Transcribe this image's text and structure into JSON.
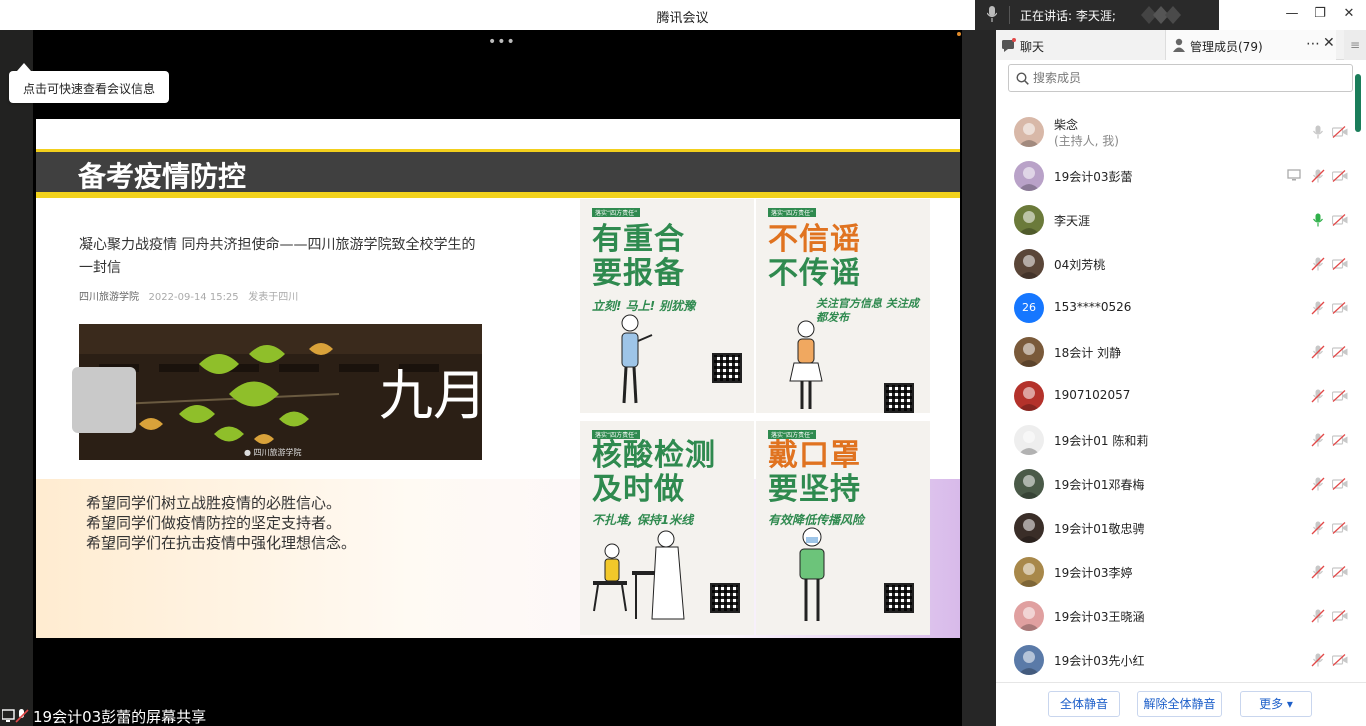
{
  "window": {
    "title": "腾讯会议",
    "speaking_label": "正在讲话: 李天涯;",
    "min_glyph": "—",
    "restore_glyph": "❐",
    "close_glyph": "✕"
  },
  "share": {
    "more_glyph": "•••",
    "tooltip": "点击可快速查看会议信息",
    "footer_label": "19会计03彭蕾的屏幕共享"
  },
  "slide": {
    "title": "备考疫情防控",
    "article_title": "凝心聚力战疫情 同舟共济担使命——四川旅游学院致全校学生的一封信",
    "article_source": "四川旅游学院",
    "article_date": "2022-09-14 15:25",
    "article_from": "发表于四川",
    "photo_text": "九月",
    "wishes": [
      "希望同学们树立战胜疫情的必胜信心。",
      "希望同学们做疫情防控的坚定支持者。",
      "希望同学们在抗击疫情中强化理想信念。"
    ],
    "posters": [
      {
        "line1": "有重合",
        "line2": "要报备",
        "sub": "立刻! 马上! 别犹豫",
        "color1": "#2f8a4f",
        "color2": "#2f8a4f"
      },
      {
        "line1": "不信谣",
        "line2": "不传谣",
        "sub": "关注官方信息 关注成都发布",
        "color1": "#e07320",
        "color2": "#2f8a4f"
      },
      {
        "line1": "核酸检测",
        "line2": "及时做",
        "sub": "不扎堆, 保持1米线",
        "color1": "#2f8a4f",
        "color2": "#2f8a4f"
      },
      {
        "line1": "戴口罩",
        "line2": "要坚持",
        "sub": "有效降低传播风险",
        "color1": "#e07320",
        "color2": "#2f8a4f"
      }
    ]
  },
  "panel": {
    "tab_chat": "聊天",
    "tab_members": "管理成员(79)",
    "tab_more": "⋯",
    "tab_close": "✕",
    "tab_menu": "≡",
    "search_placeholder": "搜索成员",
    "members": [
      {
        "name": "柴念",
        "role": "(主持人, 我)",
        "avatar_color": "#d8b8a8",
        "mic": "on-gray",
        "screen": false
      },
      {
        "name": "19会计03彭蕾",
        "role": "",
        "avatar_color": "#b9a2c8",
        "mic": "muted",
        "screen": true
      },
      {
        "name": "李天涯",
        "role": "",
        "avatar_color": "#6b7a3a",
        "mic": "speaking",
        "screen": false
      },
      {
        "name": "04刘芳桃",
        "role": "",
        "avatar_color": "#5a4638",
        "mic": "muted",
        "screen": false
      },
      {
        "name": "153****0526",
        "role": "",
        "avatar_color": "#1677ff",
        "avatar_text": "26",
        "mic": "muted",
        "screen": false
      },
      {
        "name": "18会计 刘静",
        "role": "",
        "avatar_color": "#7a5a3a",
        "mic": "muted",
        "screen": false
      },
      {
        "name": "1907102057",
        "role": "",
        "avatar_color": "#b4322b",
        "mic": "muted",
        "screen": false
      },
      {
        "name": "19会计01 陈和莉",
        "role": "",
        "avatar_color": "#eeeeee",
        "mic": "muted",
        "screen": false
      },
      {
        "name": "19会计01邓春梅",
        "role": "",
        "avatar_color": "#4a5a48",
        "mic": "muted",
        "screen": false
      },
      {
        "name": "19会计01敬忠骋",
        "role": "",
        "avatar_color": "#3a2e28",
        "mic": "muted",
        "screen": false
      },
      {
        "name": "19会计03李婷",
        "role": "",
        "avatar_color": "#a8884a",
        "mic": "muted",
        "screen": false
      },
      {
        "name": "19会计03王晓涵",
        "role": "",
        "avatar_color": "#e0a0a0",
        "mic": "muted",
        "screen": false
      },
      {
        "name": "19会计03先小红",
        "role": "",
        "avatar_color": "#5a7aa8",
        "mic": "muted",
        "screen": false
      }
    ],
    "footer": {
      "mute_all": "全体静音",
      "unmute_all": "解除全体静音",
      "more": "更多 ▾"
    }
  },
  "colors": {
    "accent": "#1d5fc9",
    "speaking_green": "#2fb04a",
    "muted_red": "#e24848",
    "scrollbar": "#1a7d5a"
  }
}
